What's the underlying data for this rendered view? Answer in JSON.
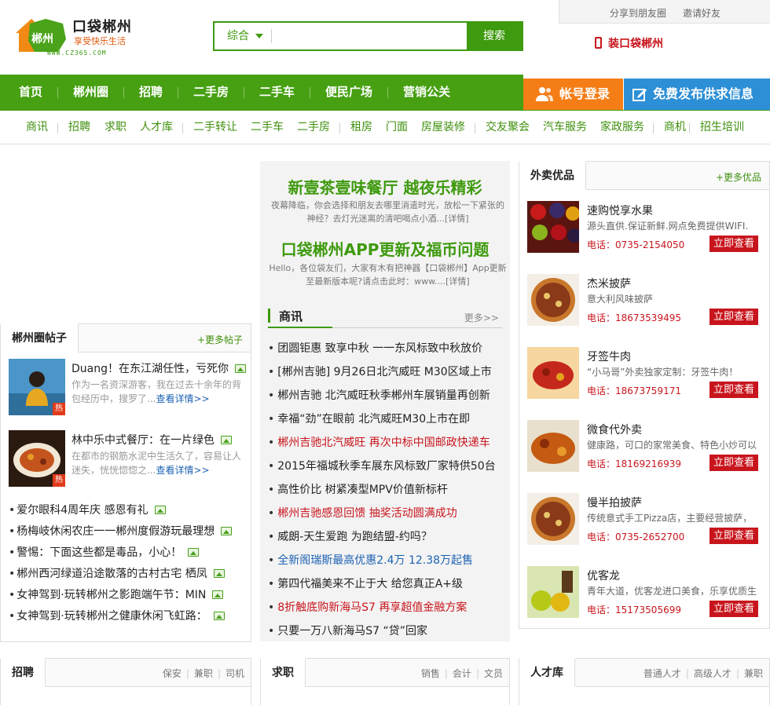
{
  "header": {
    "logo_mark": "郴州",
    "logo_title": "口袋郴州",
    "logo_slogan": "享受快乐生活",
    "logo_url": "WWW.CZ365.COM",
    "search_category": "综合",
    "search_placeholder": "",
    "search_button": "搜索",
    "share": "分享到朋友圈",
    "invite": "邀请好友",
    "app_link": "装口袋郴州"
  },
  "mainnav": [
    "首页",
    "郴州圈",
    "招聘",
    "二手房",
    "二手车",
    "便民广场",
    "营销公关"
  ],
  "login_button": "帐号登录",
  "publish_button": "免费发布供求信息",
  "subnav": [
    "商讯",
    "招聘",
    "求职",
    "人才库",
    "二手转让",
    "二手车",
    "二手房",
    "租房",
    "门面",
    "房屋装修",
    "交友聚会",
    "汽车服务",
    "家政服务",
    "商机",
    "招生培训"
  ],
  "circle": {
    "tab": "郴州圈帖子",
    "more": "+更多帖子",
    "featured": [
      {
        "title": "Duang！在东江湖任性，亏死你",
        "desc": "作为一名资深游客，我在过去十余年的背包经历中，搜罗了...",
        "link": "查看详情>>",
        "hot": "热"
      },
      {
        "title": "林中乐中式餐厅：在一片绿色",
        "desc": "在都市的钢筋水泥中生活久了，容易让人迷失，恍恍惚惚之...",
        "link": "查看详情>>",
        "hot": "热"
      }
    ],
    "posts": [
      "爱尔眼科4周年庆 感恩有礼",
      "杨梅岐休闲农庄一一郴州度假游玩最理想",
      "警惕：下面这些都是毒品，小心！",
      "郴州西河绿道沿途散落的古村古宅 栖凤",
      "女神驾到·玩转郴州之影跑端午节：MIN",
      "女神驾到·玩转郴州之健康休闲飞虹路："
    ]
  },
  "center": {
    "promo1_title": "新壹茶壹味餐厅 越夜乐精彩",
    "promo1_desc": "夜幕降临，你会选择和朋友去哪里消遣时光，放松一下紧张的神经？去灯光迷离的清吧喝点小酒...[详情]",
    "promo2_title": "口袋郴州APP更新及福币问题",
    "promo2_desc": "Hello，各位袋友们，大家有木有把神器【口袋郴州】App更新至最新版本呢?请点击此时：www....[详情]",
    "news_title": "商讯",
    "news_more": "更多>>",
    "news": [
      {
        "text": "团圆钜惠 致享中秋 一一东风标致中秋放价",
        "color": "#222"
      },
      {
        "text": "[郴州吉驰] 9月26日北汽威旺 M30区域上市",
        "color": "#222"
      },
      {
        "text": "郴州吉驰 北汽威旺秋季郴州车展销量再创新",
        "color": "#222"
      },
      {
        "text": "幸福“劲”在眼前 北汽威旺M30上市在即",
        "color": "#222"
      },
      {
        "text": "郴州吉驰北汽威旺 再次中标中国邮政快递车",
        "color": "#c8151d"
      },
      {
        "text": "2015年福城秋季车展东风标致厂家特供50台",
        "color": "#222"
      },
      {
        "text": "高性价比 树紧凑型MPV价值新标杆",
        "color": "#222"
      },
      {
        "text": "郴州吉驰感恩回馈 抽奖活动圆满成功",
        "color": "#c8151d"
      },
      {
        "text": "威朗-天生爱跑 为跑结盟-约吗？",
        "color": "#222"
      },
      {
        "text": "全新阁瑞斯最高优惠2.4万 12.38万起售",
        "color": "#1d62b4"
      },
      {
        "text": "第四代福美来不止于大 给您真正A+级",
        "color": "#222"
      },
      {
        "text": "8折触底购新海马S7 再享超值金融方案",
        "color": "#c8151d"
      },
      {
        "text": "只要一万八新海马S7 “贷”回家",
        "color": "#222"
      }
    ]
  },
  "takeout": {
    "tab": "外卖优品",
    "more": "+更多优品",
    "items": [
      {
        "name": "速购悦享水果",
        "desc": "源头直供.保证新鲜.网点免费提供WIFI.",
        "phone": "电话：0735-2154050",
        "button": "立即查看",
        "icon": "fruit-thumb"
      },
      {
        "name": "杰米披萨",
        "desc": "意大利风味披萨",
        "phone": "电话：18673539495",
        "button": "立即查看",
        "icon": "pizza-thumb"
      },
      {
        "name": "牙签牛肉",
        "desc": "“小马哥”外卖独家定制：牙签牛肉！",
        "phone": "电话：18673759171",
        "button": "立即查看",
        "icon": "beef-thumb"
      },
      {
        "name": "微食代外卖",
        "desc": "健康路，可口的家常美食、特色小炒可以",
        "phone": "电话：18169216939",
        "button": "立即查看",
        "icon": "dish-thumb"
      },
      {
        "name": "慢半拍披萨",
        "desc": "传统意式手工Pizza店，主要经营披萨，",
        "phone": "电话：0735-2652700",
        "button": "立即查看",
        "icon": "pizza-thumb"
      },
      {
        "name": "优客龙",
        "desc": "青年大道，优客龙进口美食，乐享优质生",
        "phone": "电话：15173505699",
        "button": "立即查看",
        "icon": "drinks-thumb"
      }
    ]
  },
  "bottom": {
    "jobs": {
      "tab": "招聘",
      "links": [
        "保安",
        "兼职",
        "司机"
      ]
    },
    "seek": {
      "tab": "求职",
      "links": [
        "销售",
        "会计",
        "文员"
      ]
    },
    "talent": {
      "tab": "人才库",
      "links": [
        "普通人才",
        "高级人才",
        "兼职"
      ]
    }
  },
  "colors": {
    "brand_green": "#46a012",
    "orange": "#f57d16",
    "blue": "#2d8fd6",
    "red": "#c8151d"
  }
}
